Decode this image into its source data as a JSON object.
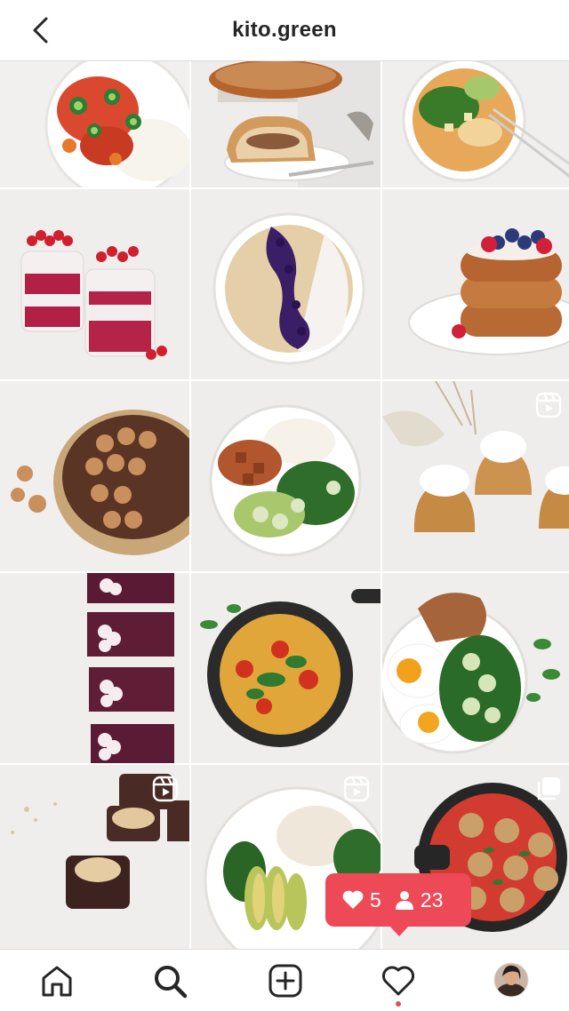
{
  "header": {
    "title": "kito.green"
  },
  "posts": [
    {
      "id": 1,
      "alt": "veggie-bowl-rice",
      "badge": ""
    },
    {
      "id": 2,
      "alt": "loaf-cake",
      "badge": ""
    },
    {
      "id": 3,
      "alt": "noodle-bowl",
      "badge": ""
    },
    {
      "id": 4,
      "alt": "redcurrant-parfait",
      "badge": ""
    },
    {
      "id": 5,
      "alt": "blueberry-smoothie-bowl",
      "badge": ""
    },
    {
      "id": 6,
      "alt": "pancake-stack",
      "badge": ""
    },
    {
      "id": 7,
      "alt": "chocolate-tart",
      "badge": ""
    },
    {
      "id": 8,
      "alt": "tofu-salad-bowl",
      "badge": ""
    },
    {
      "id": 9,
      "alt": "mini-bundt-cakes",
      "badge": "reel"
    },
    {
      "id": 10,
      "alt": "chocolate-bars",
      "badge": ""
    },
    {
      "id": 11,
      "alt": "skillet-shakshuka",
      "badge": ""
    },
    {
      "id": 12,
      "alt": "eggs-toast-salad",
      "badge": ""
    },
    {
      "id": 13,
      "alt": "chocolate-cups",
      "badge": "reel"
    },
    {
      "id": 14,
      "alt": "avocado-rice-bowl",
      "badge": "reel"
    },
    {
      "id": 15,
      "alt": "meatballs-tomato-sauce",
      "badge": "carousel"
    }
  ],
  "activity": {
    "likes": "5",
    "followers": "23"
  },
  "colors": {
    "accent": "#ed4956",
    "text": "#262626",
    "divider": "#dbdbdb"
  },
  "nav": [
    "home-icon",
    "search-icon",
    "add-post-icon",
    "heart-icon",
    "profile-avatar"
  ]
}
